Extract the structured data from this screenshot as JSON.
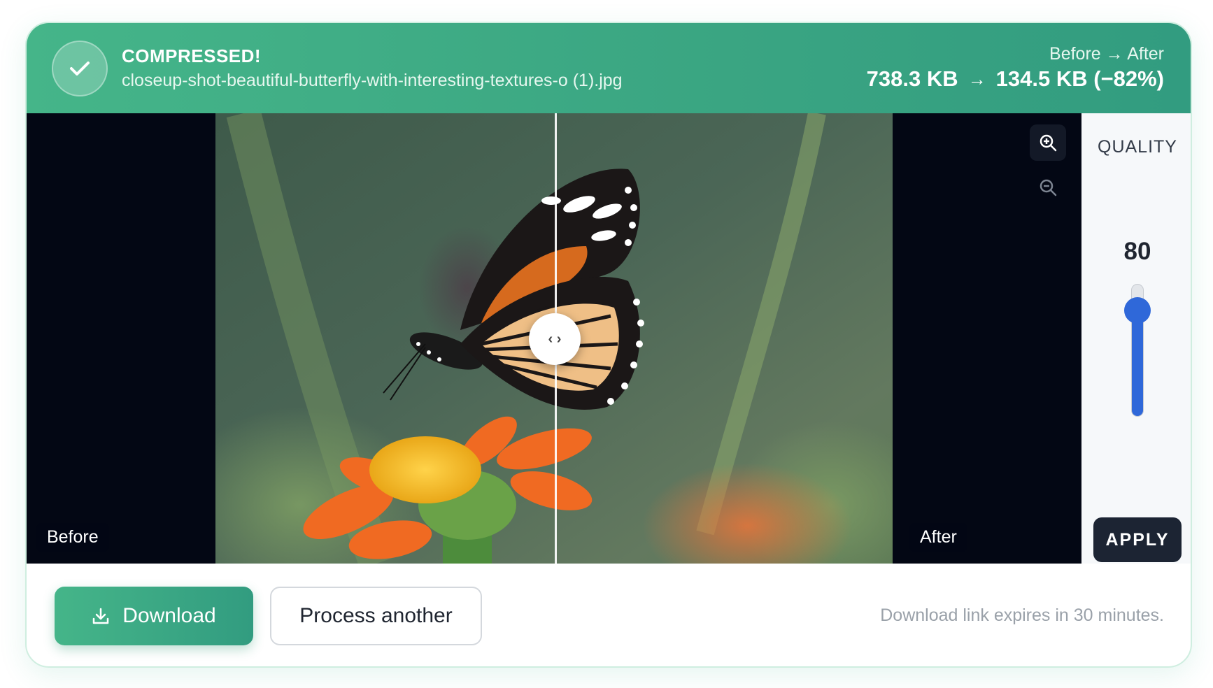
{
  "header": {
    "status": "COMPRESSED!",
    "file_name": "closeup-shot-beautiful-butterfly-with-interesting-textures-o (1).jpg",
    "before_after_caption": "Before → After",
    "original_size": "738.3 KB",
    "arrow": "→",
    "compressed_size": "134.5 KB (−82%)"
  },
  "viewer": {
    "before_label": "Before",
    "after_label": "After",
    "divider_position_pct": 50,
    "handle_glyph": "‹ ›",
    "zoom_in_icon": "zoom-in-icon",
    "zoom_out_icon": "zoom-out-icon"
  },
  "quality": {
    "label": "QUALITY",
    "value": "80",
    "slider_fraction": 0.8,
    "apply_label": "APPLY"
  },
  "footer": {
    "download_label": "Download",
    "process_another_label": "Process another",
    "expire_note": "Download link expires in 30 minutes."
  },
  "colors": {
    "brand_green": "#3aa582",
    "slider_blue": "#2f68d9",
    "dark": "#1c2433"
  }
}
